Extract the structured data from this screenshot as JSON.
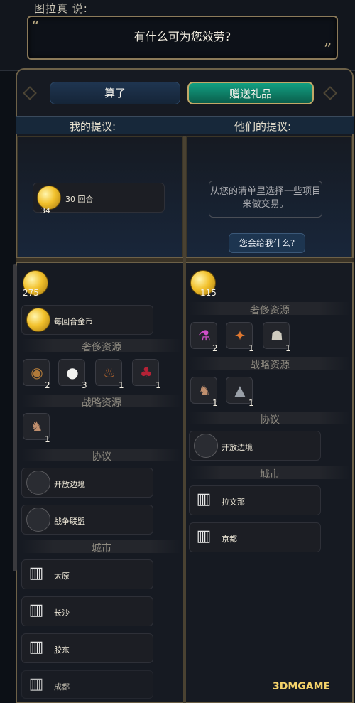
{
  "speaker": {
    "name": "图拉真 说:",
    "message": "有什么可为您效劳?",
    "quote_open": "“",
    "quote_close": "”"
  },
  "buttons": {
    "cancel": "算了",
    "gift": "赠送礼品"
  },
  "headers": {
    "mine": "我的提议:",
    "theirs": "他们的提议:"
  },
  "my_offer": {
    "item_label": "30 回合",
    "item_count": "34"
  },
  "their_offer": {
    "hint": "从您的清单里选择一些项目来做交易。",
    "ask_button": "您会给我什么?"
  },
  "my_inventory": {
    "gold": "275",
    "gold_per_turn_label": "每回合金币",
    "luxury_title": "奢侈资源",
    "luxury": [
      {
        "icon": "spices-icon",
        "count": "2"
      },
      {
        "icon": "cotton-icon",
        "count": "3"
      },
      {
        "icon": "tobacco-pipe-icon",
        "count": "1"
      },
      {
        "icon": "wine-icon",
        "count": "1"
      }
    ],
    "strategic_title": "战略资源",
    "strategic": [
      {
        "icon": "horse-icon",
        "count": "1"
      }
    ],
    "agreements_title": "协议",
    "agreements": [
      "开放边境",
      "战争联盟"
    ],
    "cities_title": "城市",
    "cities": [
      "太原",
      "长沙",
      "胶东",
      "成都"
    ]
  },
  "their_inventory": {
    "gold": "115",
    "luxury_title": "奢侈资源",
    "luxury": [
      {
        "icon": "dye-icon",
        "count": "2"
      },
      {
        "icon": "furs-icon",
        "count": "1"
      },
      {
        "icon": "marble-icon",
        "count": "1"
      }
    ],
    "strategic_title": "战略资源",
    "strategic": [
      {
        "icon": "horse-icon",
        "count": "1"
      },
      {
        "icon": "iron-icon",
        "count": "1"
      }
    ],
    "agreements_title": "协议",
    "agreements": [
      "开放边境"
    ],
    "cities_title": "城市",
    "cities": [
      "拉文那",
      "京都"
    ]
  },
  "watermark": "3DMGAME"
}
